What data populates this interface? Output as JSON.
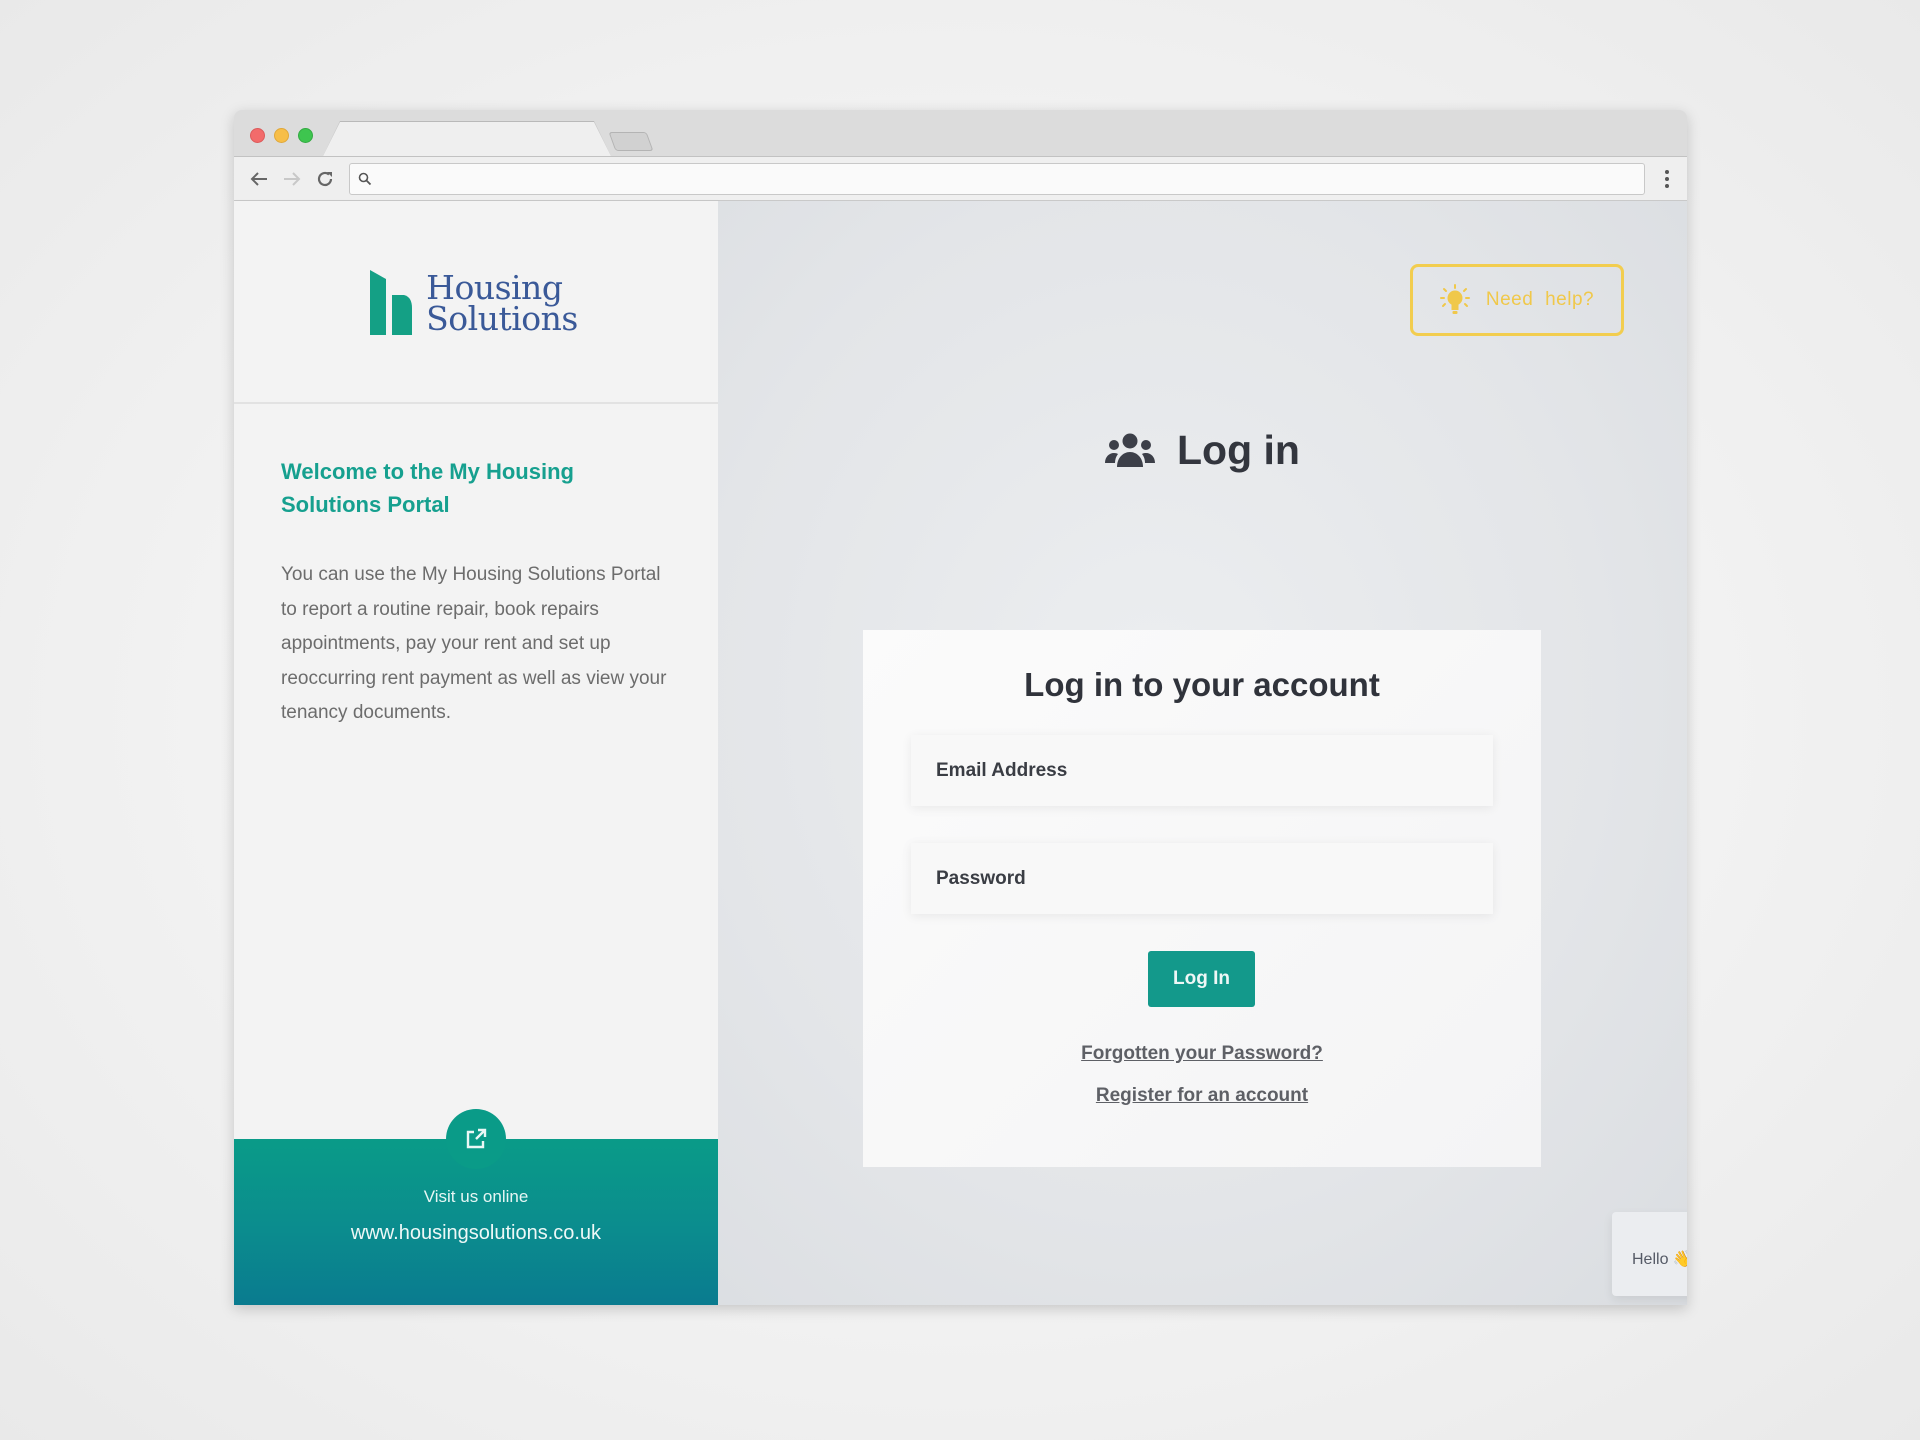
{
  "browser": {
    "url_value": "",
    "url_placeholder": "",
    "traffic_lights": [
      "close",
      "minimize",
      "maximize"
    ]
  },
  "brand": {
    "name_line1": "Housing",
    "name_line2": "Solutions",
    "primary_color": "#13998b",
    "text_color": "#3a5998"
  },
  "sidebar": {
    "welcome_title": "Welcome to the My Housing Solutions Portal",
    "welcome_body": "You can use the My Housing Solutions Portal to report a routine repair, book repairs appointments, pay your rent and set up reoccurring rent payment as well as view your tenancy documents.",
    "visit_label": "Visit us online",
    "visit_url": "www.housingsolutions.co.uk",
    "external_link_icon": "external-link-icon"
  },
  "help": {
    "label": "Need help?",
    "icon": "lightbulb-icon",
    "color": "#f2cd4f"
  },
  "login": {
    "heading": "Log in",
    "heading_icon": "users-icon",
    "card_title": "Log in to your account",
    "email_placeholder": "Email Address",
    "email_value": "",
    "password_placeholder": "Password",
    "password_value": "",
    "submit_label": "Log In",
    "forgot_link": "Forgotten your Password?",
    "register_link": "Register for an account"
  },
  "chat": {
    "message": "Hello 👋, I'm here to help.",
    "close_icon": "close-icon",
    "launcher_icon": "chat-bubbles-icon",
    "launcher_color": "#3f9b7d"
  }
}
